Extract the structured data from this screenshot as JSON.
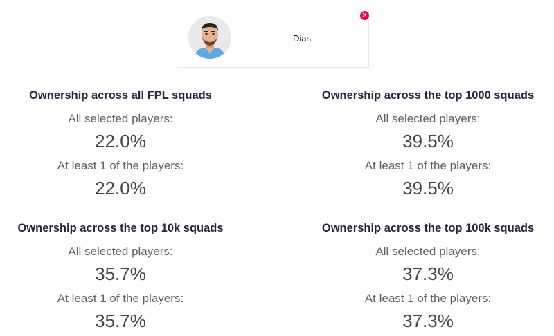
{
  "player": {
    "name": "Dias",
    "remove_icon": "close-icon"
  },
  "blocks": [
    {
      "title": "Ownership across all FPL squads",
      "all_label": "All selected players:",
      "all_value": "22.0%",
      "least_label": "At least 1 of the players:",
      "least_value": "22.0%"
    },
    {
      "title": "Ownership across the top 1000 squads",
      "all_label": "All selected players:",
      "all_value": "39.5%",
      "least_label": "At least 1 of the players:",
      "least_value": "39.5%"
    },
    {
      "title": "Ownership across the top 10k squads",
      "all_label": "All selected players:",
      "all_value": "35.7%",
      "least_label": "At least 1 of the players:",
      "least_value": "35.7%"
    },
    {
      "title": "Ownership across the top 100k squads",
      "all_label": "All selected players:",
      "all_value": "37.3%",
      "least_label": "At least 1 of the players:",
      "least_value": "37.3%"
    }
  ],
  "colors": {
    "accent": "#e90052",
    "title": "#2a2440"
  }
}
